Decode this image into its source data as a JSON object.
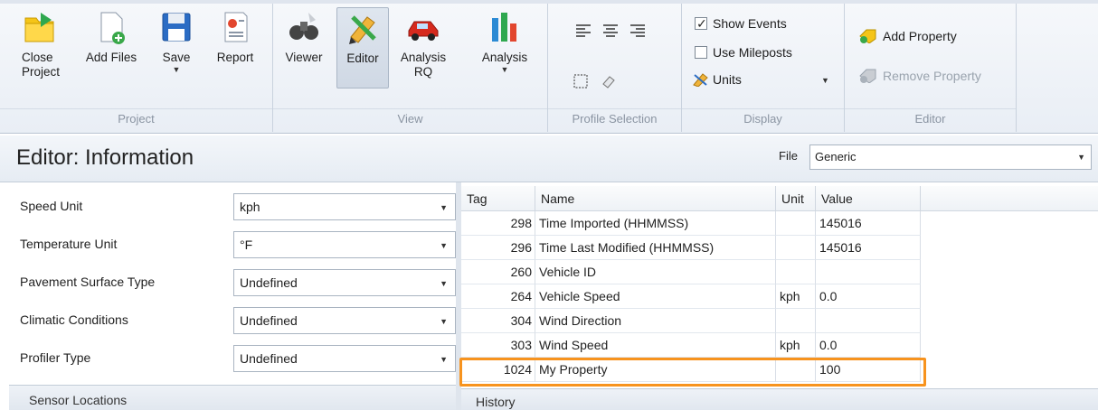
{
  "ribbon": {
    "project": {
      "group_label": "Project",
      "close": "Close\nProject",
      "add_files": "Add Files",
      "save": "Save",
      "report": "Report"
    },
    "view": {
      "group_label": "View",
      "viewer": "Viewer",
      "editor": "Editor",
      "analysis_rq": "Analysis\nRQ",
      "analysis": "Analysis"
    },
    "profile_selection": {
      "group_label": "Profile Selection"
    },
    "display": {
      "group_label": "Display",
      "show_events": "Show Events",
      "show_events_checked": true,
      "use_mileposts": "Use Mileposts",
      "use_mileposts_checked": false,
      "units": "Units"
    },
    "editor": {
      "group_label": "Editor",
      "add_property": "Add Property",
      "remove_property": "Remove Property"
    }
  },
  "editor_header": {
    "title": "Editor: Information",
    "file_label": "File",
    "file_value": "Generic"
  },
  "properties": [
    {
      "label": "Speed Unit",
      "value": "kph"
    },
    {
      "label": "Temperature Unit",
      "value": "°F"
    },
    {
      "label": "Pavement Surface Type",
      "value": "Undefined"
    },
    {
      "label": "Climatic Conditions",
      "value": "Undefined"
    },
    {
      "label": "Profiler Type",
      "value": "Undefined"
    }
  ],
  "left_section": "Sensor Locations",
  "table": {
    "headers": {
      "tag": "Tag",
      "name": "Name",
      "unit": "Unit",
      "value": "Value"
    },
    "rows": [
      {
        "tag": "298",
        "name": "Time Imported (HHMMSS)",
        "unit": "",
        "value": "145016"
      },
      {
        "tag": "296",
        "name": "Time Last Modified (HHMMSS)",
        "unit": "",
        "value": "145016"
      },
      {
        "tag": "260",
        "name": "Vehicle ID",
        "unit": "",
        "value": ""
      },
      {
        "tag": "264",
        "name": "Vehicle Speed",
        "unit": "kph",
        "value": "0.0"
      },
      {
        "tag": "304",
        "name": "Wind Direction",
        "unit": "",
        "value": ""
      },
      {
        "tag": "303",
        "name": "Wind Speed",
        "unit": "kph",
        "value": "0.0"
      },
      {
        "tag": "1024",
        "name": "My Property",
        "unit": "",
        "value": "100"
      }
    ]
  },
  "right_section": "History",
  "colors": {
    "highlight": "#f7931e",
    "accent_blue": "#2b6cc4"
  }
}
